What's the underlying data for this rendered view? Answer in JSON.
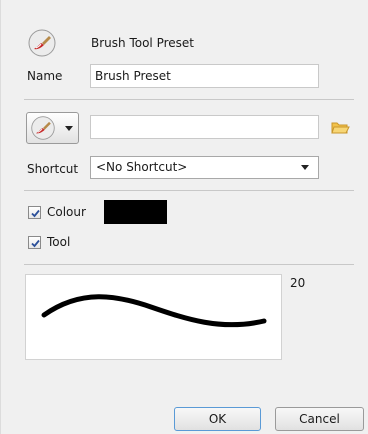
{
  "header": {
    "title": "Brush Tool Preset",
    "icon": "brush-tool-icon"
  },
  "name_field": {
    "label": "Name",
    "value": "Brush Preset"
  },
  "tool_picker": {
    "icon": "brush-tool-icon",
    "dropdown_icon": "small-down-arrow-icon"
  },
  "path_field": {
    "value": "",
    "browse_icon": "folder-icon"
  },
  "shortcut": {
    "label": "Shortcut",
    "selected": "<No Shortcut>"
  },
  "colour": {
    "label": "Colour",
    "checked": true,
    "swatch_color": "#000000"
  },
  "tool": {
    "label": "Tool",
    "checked": true
  },
  "preview": {
    "size_value": "20"
  },
  "buttons": {
    "ok": "OK",
    "cancel": "Cancel"
  }
}
